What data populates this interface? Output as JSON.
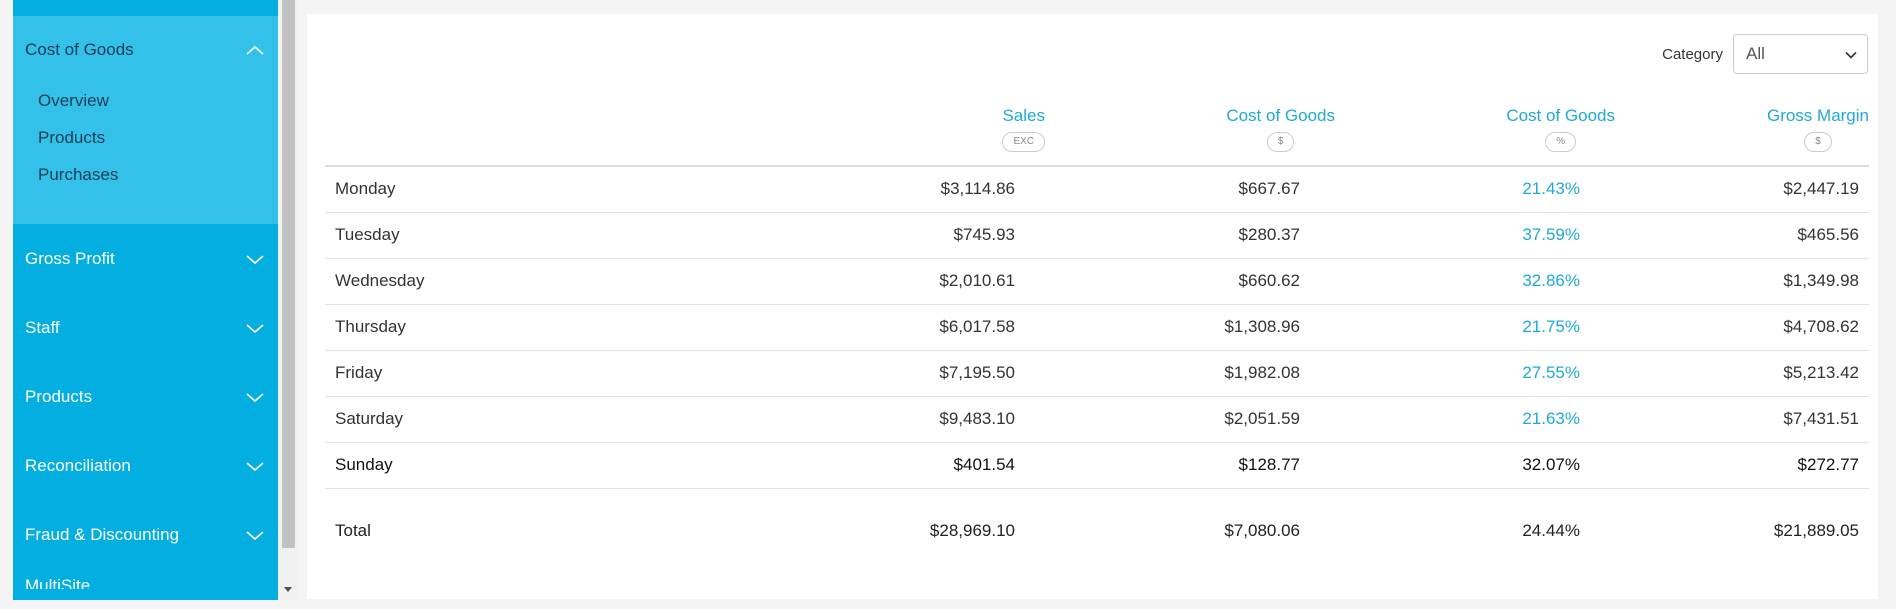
{
  "sidebar": {
    "open_section": {
      "label": "Cost of Goods",
      "items": [
        "Overview",
        "Products",
        "Purchases"
      ]
    },
    "sections": [
      {
        "label": "Gross Profit"
      },
      {
        "label": "Staff"
      },
      {
        "label": "Products"
      },
      {
        "label": "Reconciliation"
      },
      {
        "label": "Fraud & Discounting"
      }
    ],
    "cut_off_label": "MultiSite"
  },
  "filter": {
    "label": "Category",
    "selected": "All"
  },
  "table": {
    "columns": [
      {
        "title": "Sales",
        "badge": "EXC"
      },
      {
        "title": "Cost of Goods",
        "badge": "$"
      },
      {
        "title": "Cost of Goods",
        "badge": "%"
      },
      {
        "title": "Gross Margin",
        "badge": "$"
      }
    ],
    "rows": [
      {
        "day": "Monday",
        "sales": "$3,114.86",
        "cog": "$667.67",
        "cog_pct": "21.43%",
        "margin": "$2,447.19"
      },
      {
        "day": "Tuesday",
        "sales": "$745.93",
        "cog": "$280.37",
        "cog_pct": "37.59%",
        "margin": "$465.56"
      },
      {
        "day": "Wednesday",
        "sales": "$2,010.61",
        "cog": "$660.62",
        "cog_pct": "32.86%",
        "margin": "$1,349.98"
      },
      {
        "day": "Thursday",
        "sales": "$6,017.58",
        "cog": "$1,308.96",
        "cog_pct": "21.75%",
        "margin": "$4,708.62"
      },
      {
        "day": "Friday",
        "sales": "$7,195.50",
        "cog": "$1,982.08",
        "cog_pct": "27.55%",
        "margin": "$5,213.42"
      },
      {
        "day": "Saturday",
        "sales": "$9,483.10",
        "cog": "$2,051.59",
        "cog_pct": "21.63%",
        "margin": "$7,431.51"
      },
      {
        "day": "Sunday",
        "sales": "$401.54",
        "cog": "$128.77",
        "cog_pct": "32.07%",
        "margin": "$272.77"
      }
    ],
    "total": {
      "label": "Total",
      "sales": "$28,969.10",
      "cog": "$7,080.06",
      "cog_pct": "24.44%",
      "margin": "$21,889.05"
    }
  },
  "colors": {
    "sidebar_bg": "#03aee0",
    "sidebar_open_bg": "#33c1ea",
    "accent": "#1fa9d8"
  }
}
